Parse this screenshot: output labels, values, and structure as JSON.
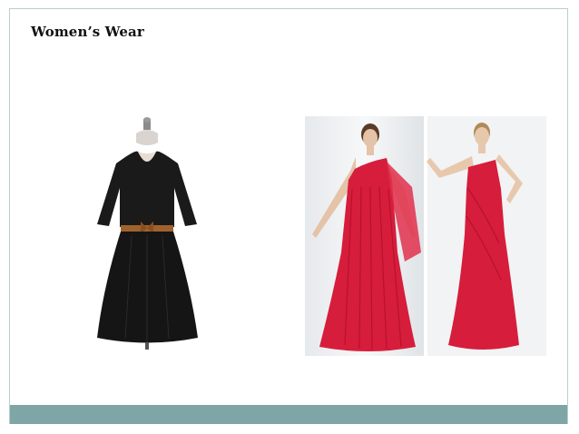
{
  "slide": {
    "title": "Women’s Wear"
  },
  "images": [
    {
      "name": "black-dress-photo",
      "description_icon": "dress-on-mannequin"
    },
    {
      "name": "red-gowns-photo",
      "description_icon": "two-models-red-gowns"
    }
  ],
  "colors": {
    "frame_border": "#b7cfd0",
    "footer_bar": "#7fa5a6",
    "dress_black": "#1a1a1a",
    "belt_brown": "#a0622d",
    "gown_red": "#d61d3c"
  }
}
